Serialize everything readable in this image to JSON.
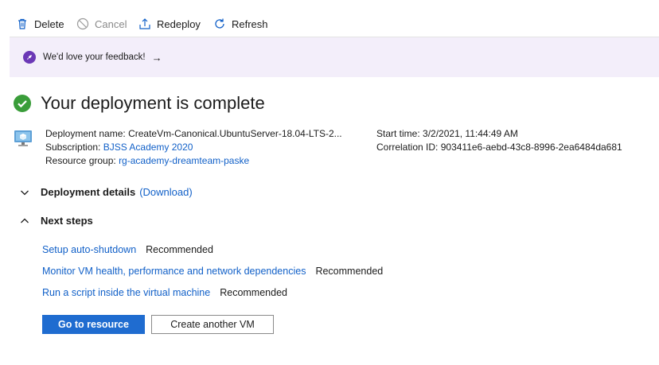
{
  "toolbar": {
    "delete_label": "Delete",
    "cancel_label": "Cancel",
    "redeploy_label": "Redeploy",
    "refresh_label": "Refresh"
  },
  "feedback": {
    "text": "We'd love your feedback!",
    "arrow": "→"
  },
  "status": {
    "title": "Your deployment is complete",
    "color": "#3a9d3a"
  },
  "details": {
    "deployment_name_label": "Deployment name:",
    "deployment_name_value": "CreateVm-Canonical.UbuntuServer-18.04-LTS-2...",
    "subscription_label": "Subscription:",
    "subscription_value": "BJSS Academy 2020",
    "resource_group_label": "Resource group:",
    "resource_group_value": "rg-academy-dreamteam-paske",
    "start_time_label": "Start time:",
    "start_time_value": "3/2/2021, 11:44:49 AM",
    "correlation_id_label": "Correlation ID:",
    "correlation_id_value": "903411e6-aebd-43c8-8996-2ea6484da681"
  },
  "sections": {
    "deployment_details_label": "Deployment details",
    "download_label": "(Download)",
    "next_steps_label": "Next steps"
  },
  "next_steps": [
    {
      "link": "Setup auto-shutdown",
      "tag": "Recommended"
    },
    {
      "link": "Monitor VM health, performance and network dependencies",
      "tag": "Recommended"
    },
    {
      "link": "Run a script inside the virtual machine",
      "tag": "Recommended"
    }
  ],
  "buttons": {
    "primary_label": "Go to resource",
    "secondary_label": "Create another VM"
  },
  "colors": {
    "accent": "#1f6cd0",
    "link": "#1160c8",
    "feedback_bg": "#f3eefa",
    "rocket": "#6b38b6"
  }
}
